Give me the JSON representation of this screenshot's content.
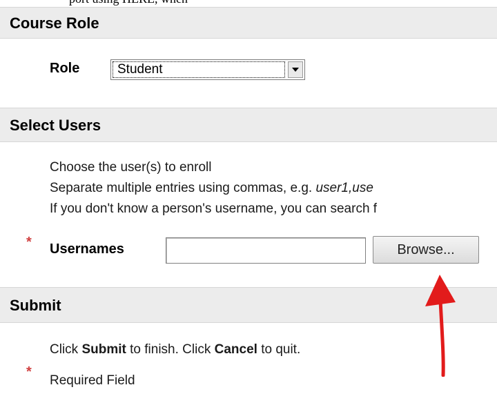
{
  "top_cut_text": "port using HERE, when",
  "sections": {
    "course_role": {
      "title": "Course Role"
    },
    "select_users": {
      "title": "Select Users"
    },
    "submit": {
      "title": "Submit"
    }
  },
  "role": {
    "label": "Role",
    "selected_value": "Student"
  },
  "instructions": {
    "line1": "Choose the user(s) to enroll",
    "line2_prefix": "Separate multiple entries using commas, e.g. ",
    "line2_example": "user1,use",
    "line3": "If you don't know a person's username, you can search f"
  },
  "usernames": {
    "required_marker": "*",
    "label": "Usernames",
    "value": "",
    "browse_label": "Browse..."
  },
  "submit_text": {
    "part1": "Click ",
    "submit_word": "Submit",
    "part2": " to finish. Click ",
    "cancel_word": "Cancel",
    "part3": " to quit."
  },
  "required_field": {
    "marker": "*",
    "label": "Required Field"
  },
  "colors": {
    "header_bg": "#ececec",
    "required_star": "#d04040",
    "annotation_arrow": "#e21b1b"
  }
}
